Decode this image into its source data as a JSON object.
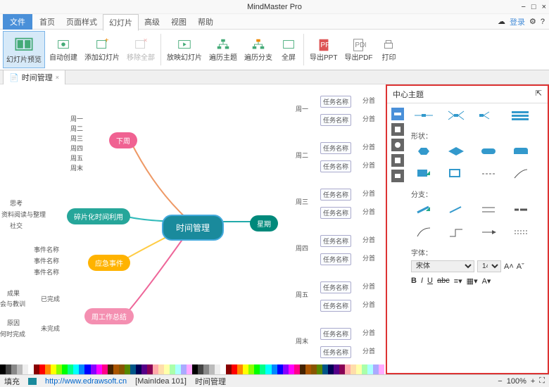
{
  "app_title": "MindMaster Pro",
  "window_controls": {
    "min": "−",
    "max": "□",
    "close": "×"
  },
  "menu": {
    "file": "文件",
    "items": [
      "首页",
      "页面样式",
      "幻灯片",
      "高级",
      "视图",
      "帮助"
    ],
    "active_index": 2,
    "login": "登录",
    "help_icon": "?"
  },
  "ribbon": [
    {
      "id": "preview",
      "label": "幻灯片预览",
      "active": true
    },
    {
      "id": "auto",
      "label": "自动创建"
    },
    {
      "id": "add",
      "label": "添加幻灯片"
    },
    {
      "id": "del",
      "label": "移除全部",
      "disabled": true
    },
    {
      "sep": true
    },
    {
      "id": "play",
      "label": "放映幻灯片"
    },
    {
      "id": "browse",
      "label": "遍历主题"
    },
    {
      "id": "browse2",
      "label": "遍历分支"
    },
    {
      "id": "full",
      "label": "全屏"
    },
    {
      "sep": true
    },
    {
      "id": "ppt",
      "label": "导出PPT"
    },
    {
      "id": "pdf",
      "label": "导出PDF"
    },
    {
      "id": "print",
      "label": "打印"
    }
  ],
  "doc_tab": {
    "name": "时间管理",
    "close": "×"
  },
  "mindmap": {
    "center": "时间管理",
    "nodes": {
      "next_week": "下周",
      "fragment": "碎片化时间利用",
      "emergency": "应急事件",
      "summary": "周工作总结",
      "week": "星期"
    },
    "next_week_children": [
      "周一",
      "周二",
      "周三",
      "周四",
      "周五",
      "周末"
    ],
    "fragment_children": [
      "思考",
      "资料阅读与整理",
      "社交"
    ],
    "emergency_children": [
      "事件名称",
      "事件名称",
      "事件名称"
    ],
    "summary_groups": [
      {
        "t": "已完成",
        "c": [
          "成果",
          "会与教训"
        ]
      },
      {
        "t": "未完成",
        "c": [
          "原因",
          "何时完成"
        ]
      }
    ],
    "week_days": [
      "周一",
      "周二",
      "周三",
      "周四",
      "周五",
      "周末"
    ],
    "task_label": "任务名称",
    "branch_label": "分首"
  },
  "sidepanel": {
    "title": "中心主题",
    "sections": {
      "shape": "形状：",
      "branch": "分支：",
      "font": "字体："
    },
    "font_name": "宋体",
    "font_size": "14"
  },
  "statusbar": {
    "fill": "填充",
    "url": "http://www.edrawsoft.cn",
    "doc": "[MainIdea 101]",
    "title": "时间管理",
    "zoom": "100%"
  }
}
